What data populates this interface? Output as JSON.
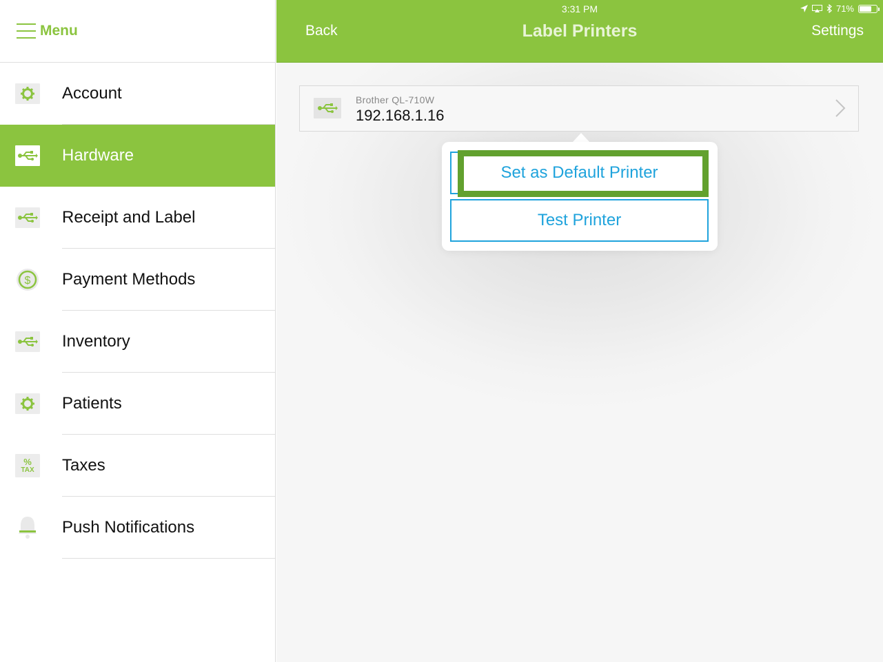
{
  "sidebar": {
    "menu_label": "Menu",
    "items": [
      {
        "label": "Account",
        "icon": "gear-icon",
        "active": false
      },
      {
        "label": "Hardware",
        "icon": "usb-icon",
        "active": true
      },
      {
        "label": "Receipt and Label",
        "icon": "usb-icon",
        "active": false
      },
      {
        "label": "Payment Methods",
        "icon": "dollar-icon",
        "active": false
      },
      {
        "label": "Inventory",
        "icon": "usb-icon",
        "active": false
      },
      {
        "label": "Patients",
        "icon": "gear-icon",
        "active": false
      },
      {
        "label": "Taxes",
        "icon": "tax-icon",
        "icon_text": "TAX",
        "active": false
      },
      {
        "label": "Push Notifications",
        "icon": "bell-icon",
        "active": false
      }
    ]
  },
  "status_bar": {
    "time": "3:31 PM",
    "battery": "71%",
    "battery_level": 0.71
  },
  "navbar": {
    "back": "Back",
    "title": "Label Printers",
    "settings": "Settings"
  },
  "printer": {
    "name": "Brother QL-710W",
    "ip": "192.168.1.16",
    "icon": "usb-icon"
  },
  "popover": {
    "set_default": "Set as Default Printer",
    "test": "Test Printer"
  },
  "colors": {
    "accent_green": "#8bc43f",
    "highlight_green": "#62a12e",
    "button_blue": "#1fa3dc"
  }
}
